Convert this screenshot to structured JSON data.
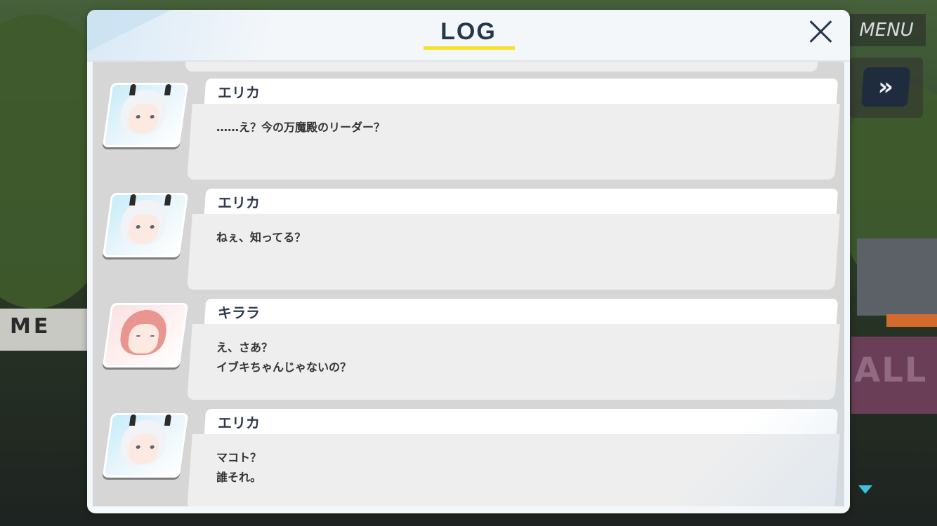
{
  "header": {
    "title": "LOG",
    "close_icon": "close-icon"
  },
  "controls": {
    "menu_label": "MENU",
    "fast_forward_icon": "fast-forward-icon",
    "fast_forward_glyph": "»",
    "scroll_indicator_icon": "scroll-down-icon"
  },
  "entries": [
    {
      "speaker": "エリカ",
      "text": "……え？今の万魔殿のリーダー？",
      "avatar": "erika-avatar"
    },
    {
      "speaker": "エリカ",
      "text": "ねぇ、知ってる？",
      "avatar": "erika-avatar"
    },
    {
      "speaker": "キララ",
      "text": "え、さあ？\nイブキちゃんじゃないの？",
      "avatar": "kirara-avatar"
    },
    {
      "speaker": "エリカ",
      "text": "マコト？\n誰それ。",
      "avatar": "erika-avatar"
    }
  ],
  "colors": {
    "title": "#26364f",
    "title_underline": "#f5e22e",
    "accent_cyan": "#3dc2d9"
  }
}
